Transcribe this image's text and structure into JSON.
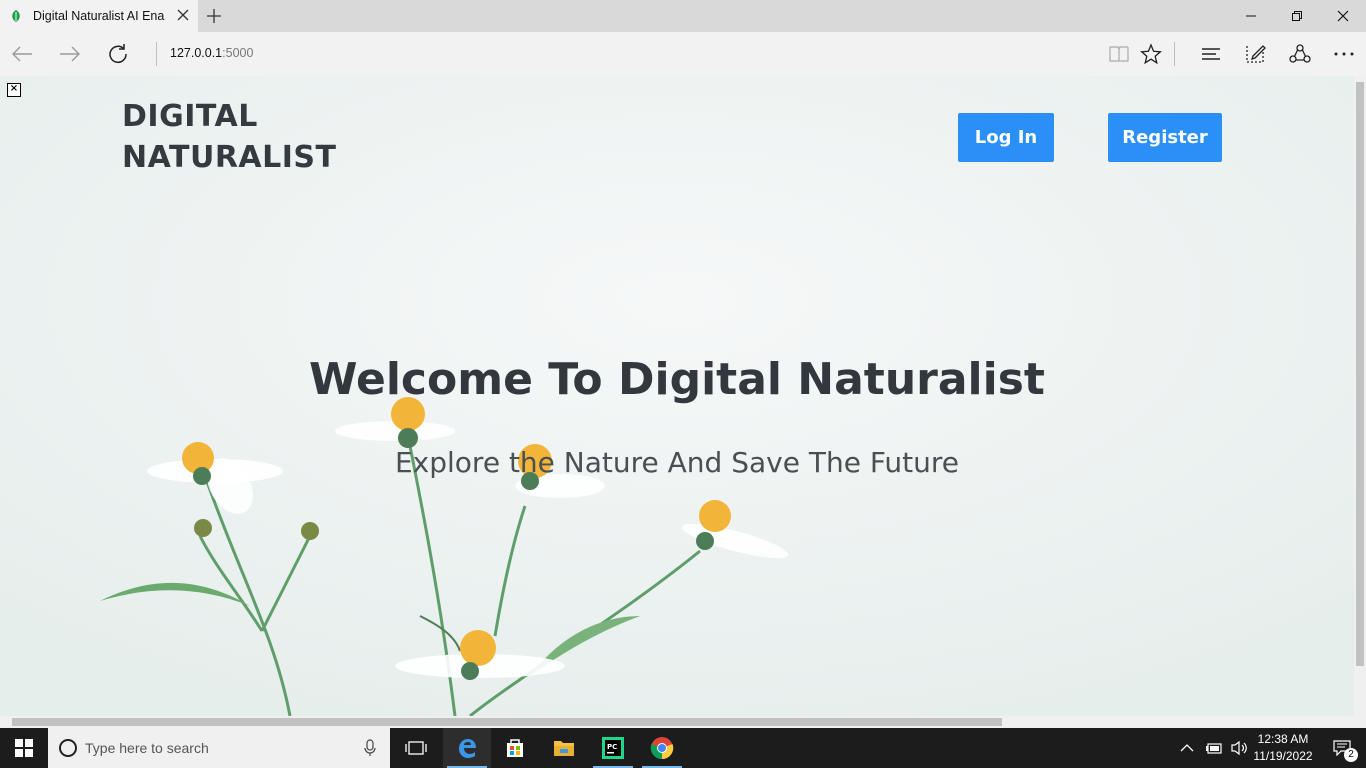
{
  "browser": {
    "tab_title": "Digital Naturalist AI Ena",
    "url_host": "127.0.0.1",
    "url_port": ":5000"
  },
  "page": {
    "brand": "DIGITAL NATURALIST",
    "login_label": "Log In",
    "register_label": "Register",
    "hero_title": "Welcome To Digital Naturalist",
    "hero_subtitle": "Explore the Nature And Save The Future",
    "close_glyph": "×"
  },
  "taskbar": {
    "search_placeholder": "Type here to search",
    "time": "12:38 AM",
    "date": "11/19/2022",
    "notification_count": "2"
  },
  "colors": {
    "accent_button": "#2a8ff7",
    "heading_text": "#32383e",
    "page_background": "#eef3f2",
    "taskbar": "#1c1c1c"
  },
  "icons": {
    "tab": "leaf-favicon-icon",
    "nav": [
      "back-arrow-icon",
      "forward-arrow-icon",
      "refresh-icon"
    ],
    "toolbar": [
      "reading-view-icon",
      "favorite-star-icon",
      "hub-icon",
      "web-note-icon",
      "share-icon",
      "more-icon"
    ]
  }
}
